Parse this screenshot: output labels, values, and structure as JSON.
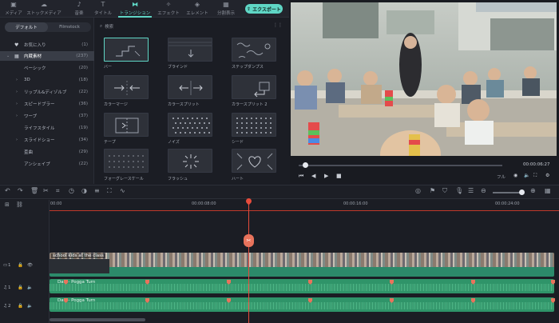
{
  "tabs": [
    {
      "label": "メディア",
      "icon": "folder-icon"
    },
    {
      "label": "ストックメディア",
      "icon": "cloud-icon"
    },
    {
      "label": "音楽",
      "icon": "music-icon"
    },
    {
      "label": "タイトル",
      "icon": "title-icon"
    },
    {
      "label": "トランジション",
      "icon": "transition-icon"
    },
    {
      "label": "エフェクト",
      "icon": "effect-icon"
    },
    {
      "label": "エレメント",
      "icon": "element-icon"
    },
    {
      "label": "分割表示",
      "icon": "split-icon"
    }
  ],
  "export_label": "エクスポート",
  "left_tabs": [
    "デフォルト",
    "Filmstock"
  ],
  "categories": [
    {
      "label": "お気に入り",
      "count": "(1)",
      "icon": "heart-icon"
    },
    {
      "label": "内蔵素材",
      "count": "(237)",
      "icon": "grid-icon"
    },
    {
      "label": "ベーシック",
      "count": "(20)"
    },
    {
      "label": "3D",
      "count": "(18)"
    },
    {
      "label": "リップル&ディゾルブ",
      "count": "(22)"
    },
    {
      "label": "スピードブラー",
      "count": "(36)"
    },
    {
      "label": "ワープ",
      "count": "(37)"
    },
    {
      "label": "ライフスタイル",
      "count": "(19)"
    },
    {
      "label": "スライドショー",
      "count": "(34)"
    },
    {
      "label": "歪曲",
      "count": "(29)"
    },
    {
      "label": "アンシェイプ",
      "count": "(22)"
    }
  ],
  "search_placeholder": "検索",
  "transitions": [
    {
      "label": "バー"
    },
    {
      "label": "ブラインド"
    },
    {
      "label": "ステップダンプス"
    },
    {
      "label": "カラーマージ"
    },
    {
      "label": "カラースプリット"
    },
    {
      "label": "カラースプリット 2"
    },
    {
      "label": "テープ"
    },
    {
      "label": "ノイズ"
    },
    {
      "label": "シード"
    },
    {
      "label": "フォーグレースケール"
    },
    {
      "label": "フラッシュ"
    },
    {
      "label": "ハート"
    }
  ],
  "preview": {
    "timecode": "00:00:06:27",
    "quality": "フル"
  },
  "ruler": [
    "00:00",
    "00:00:08:00",
    "00:00:16:00",
    "00:00:24:00"
  ],
  "tracks": {
    "video": {
      "label": "1",
      "clip_title": "school kids at the class"
    },
    "audio1": {
      "label": "1",
      "clip_title": "Daft - Pogga Turn"
    },
    "audio2": {
      "label": "2",
      "clip_title": "Daft - Pogga Turn"
    }
  },
  "colors": {
    "accent": "#5fd6c5",
    "playhead": "#e74c3c",
    "clip": "#2f9469"
  }
}
